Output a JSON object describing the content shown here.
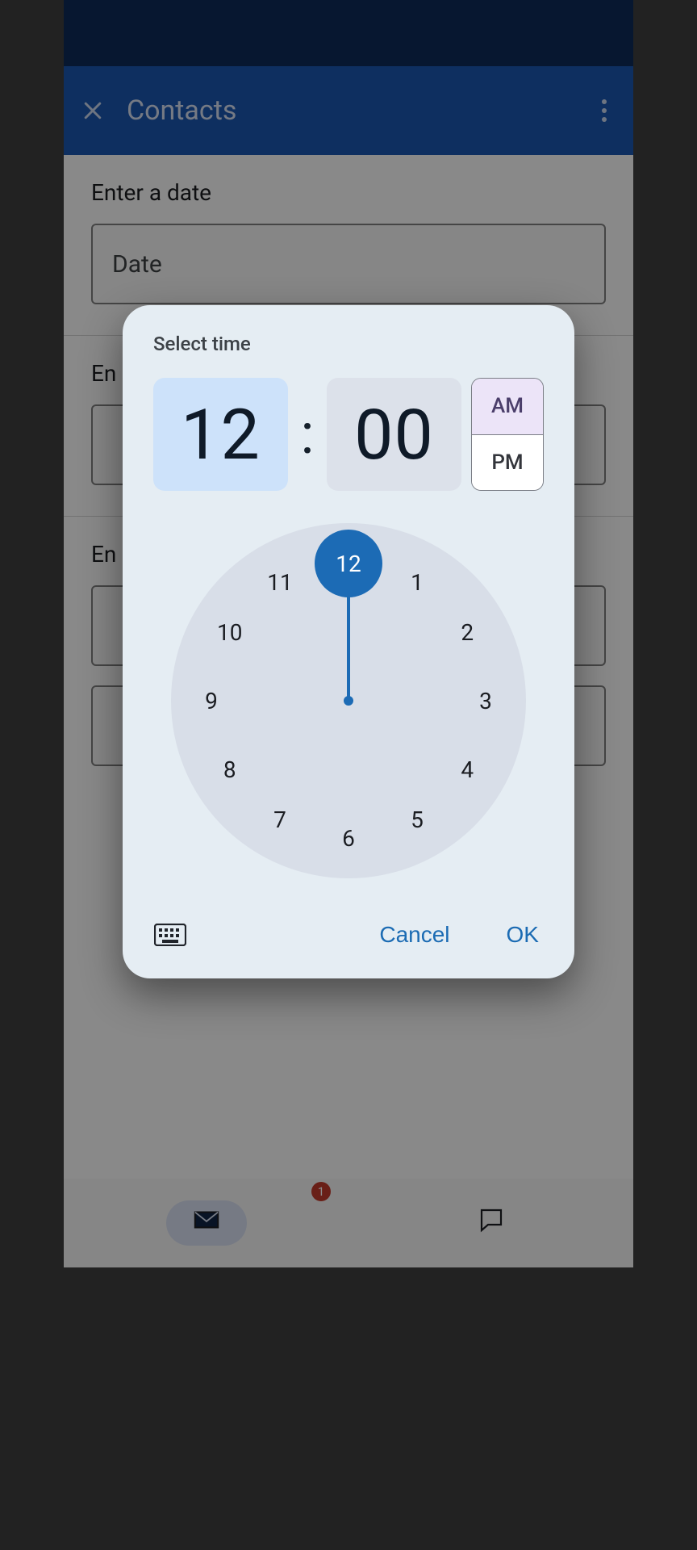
{
  "appbar": {
    "title": "Contacts"
  },
  "sections": {
    "date": {
      "label": "Enter a date",
      "placeholder": "Date"
    },
    "time": {
      "label": "En"
    },
    "other": {
      "label": "En"
    }
  },
  "dialog": {
    "title": "Select time",
    "hour": "12",
    "minute": "00",
    "am": "AM",
    "pm": "PM",
    "selected_period": "AM",
    "cancel": "Cancel",
    "ok": "OK",
    "clock_numbers": [
      "12",
      "1",
      "2",
      "3",
      "4",
      "5",
      "6",
      "7",
      "8",
      "9",
      "10",
      "11"
    ],
    "selected_hour_label": "12"
  },
  "bottomnav": {
    "badge": "1"
  }
}
